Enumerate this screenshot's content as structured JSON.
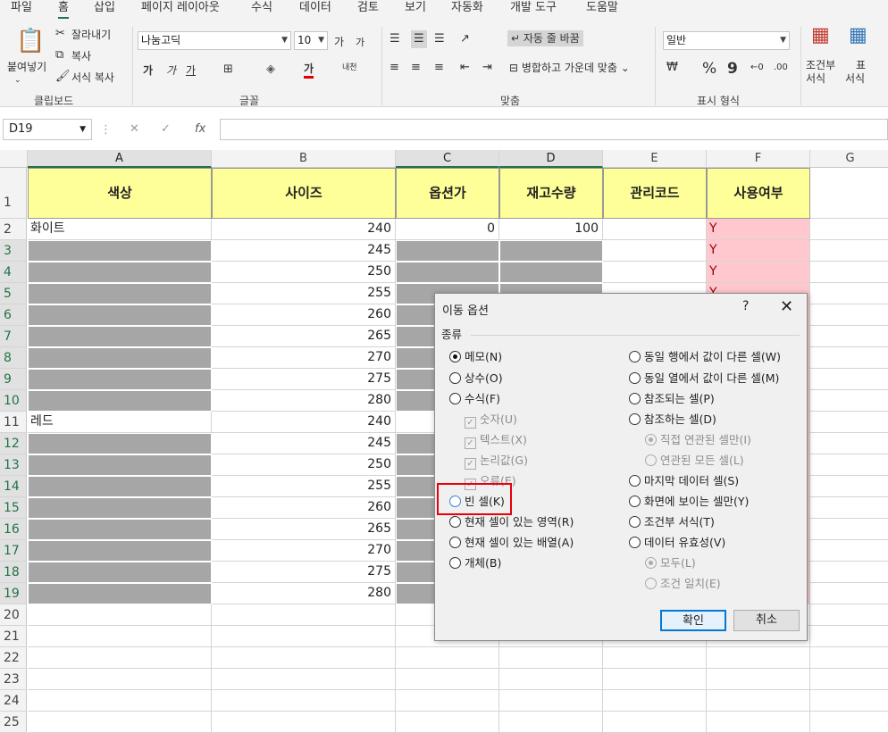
{
  "menu": [
    "파일",
    "홈",
    "삽입",
    "페이지 레이아웃",
    "수식",
    "데이터",
    "검토",
    "보기",
    "자동화",
    "개발 도구",
    "도움말"
  ],
  "active_menu": "홈",
  "ribbon": {
    "clipboard": {
      "paste": "붙여넣기",
      "cut": "잘라내기",
      "copy": "복사",
      "format_painter": "서식 복사",
      "group": "클립보드"
    },
    "font": {
      "name": "나눔고딕",
      "size": "10",
      "grow": "가",
      "shrink": "가",
      "bold": "가",
      "italic": "가",
      "underline": "가",
      "color_glyph": "가",
      "phonetic": "내천",
      "group": "글꼴"
    },
    "align": {
      "wrap": "자동 줄 바꿈",
      "merge": "병합하고 가운데 맞춤",
      "group": "맞춤"
    },
    "number": {
      "format": "일반",
      "percent": "%",
      "comma": "9",
      "group": "표시 형식"
    },
    "styles": {
      "cond": "조건부",
      "cond2": "서식",
      "table": "표",
      "table2": "서식"
    }
  },
  "formula_bar": {
    "name_box": "D19",
    "fx": "fx"
  },
  "columns": [
    "A",
    "B",
    "C",
    "D",
    "E",
    "F",
    "G"
  ],
  "header_row": [
    "색상",
    "사이즈",
    "옵션가",
    "재고수량",
    "관리코드",
    "사용여부"
  ],
  "rows": [
    {
      "n": "1"
    },
    {
      "n": "2",
      "a": "화이트",
      "b": "240",
      "c": "0",
      "d": "100",
      "f": "Y"
    },
    {
      "n": "3",
      "b": "245",
      "f": "Y"
    },
    {
      "n": "4",
      "b": "250",
      "f": "Y"
    },
    {
      "n": "5",
      "b": "255",
      "f": "Y"
    },
    {
      "n": "6",
      "b": "260"
    },
    {
      "n": "7",
      "b": "265"
    },
    {
      "n": "8",
      "b": "270"
    },
    {
      "n": "9",
      "b": "275"
    },
    {
      "n": "10",
      "b": "280"
    },
    {
      "n": "11",
      "a": "레드",
      "b": "240"
    },
    {
      "n": "12",
      "b": "245"
    },
    {
      "n": "13",
      "b": "250"
    },
    {
      "n": "14",
      "b": "255"
    },
    {
      "n": "15",
      "b": "260"
    },
    {
      "n": "16",
      "b": "265"
    },
    {
      "n": "17",
      "b": "270"
    },
    {
      "n": "18",
      "b": "275"
    },
    {
      "n": "19",
      "b": "280"
    },
    {
      "n": "20"
    },
    {
      "n": "21"
    },
    {
      "n": "22"
    },
    {
      "n": "23"
    },
    {
      "n": "24"
    },
    {
      "n": "25"
    }
  ],
  "dialog": {
    "title": "이동 옵션",
    "help": "?",
    "close": "✕",
    "section": "종류",
    "left": [
      {
        "label": "메모(N)",
        "type": "radio",
        "checked": true
      },
      {
        "label": "상수(O)",
        "type": "radio"
      },
      {
        "label": "수식(F)",
        "type": "radio"
      },
      {
        "label": "숫자(U)",
        "type": "check",
        "disabled": true
      },
      {
        "label": "텍스트(X)",
        "type": "check",
        "disabled": true
      },
      {
        "label": "논리값(G)",
        "type": "check",
        "disabled": true
      },
      {
        "label": "오류(E)",
        "type": "check",
        "disabled": true
      },
      {
        "label": "빈 셀(K)",
        "type": "radio",
        "highlight": true
      },
      {
        "label": "현재 셀이 있는 영역(R)",
        "type": "radio"
      },
      {
        "label": "현재 셀이 있는 배열(A)",
        "type": "radio"
      },
      {
        "label": "개체(B)",
        "type": "radio"
      }
    ],
    "right": [
      {
        "label": "동일 행에서 값이 다른 셀(W)",
        "type": "radio"
      },
      {
        "label": "동일 열에서 값이 다른 셀(M)",
        "type": "radio"
      },
      {
        "label": "참조되는 셀(P)",
        "type": "radio"
      },
      {
        "label": "참조하는 셀(D)",
        "type": "radio"
      },
      {
        "label": "직접 연관된 셀만(I)",
        "type": "radio",
        "disabled": true,
        "checked": true,
        "indent": true
      },
      {
        "label": "연관된 모든 셀(L)",
        "type": "radio",
        "disabled": true,
        "indent": true
      },
      {
        "label": "마지막 데이터 셀(S)",
        "type": "radio"
      },
      {
        "label": "화면에 보이는 셀만(Y)",
        "type": "radio"
      },
      {
        "label": "조건부 서식(T)",
        "type": "radio"
      },
      {
        "label": "데이터 유효성(V)",
        "type": "radio"
      },
      {
        "label": "모두(L)",
        "type": "radio",
        "disabled": true,
        "checked": true,
        "indent": true
      },
      {
        "label": "조건 일치(E)",
        "type": "radio",
        "disabled": true,
        "indent": true
      }
    ],
    "ok": "확인",
    "cancel": "취소"
  },
  "colors": {
    "header_fill": "#ffff99",
    "gray_fill": "#a6a6a6",
    "pink_fill": "#ffc7ce",
    "highlight": "#e8000b"
  }
}
